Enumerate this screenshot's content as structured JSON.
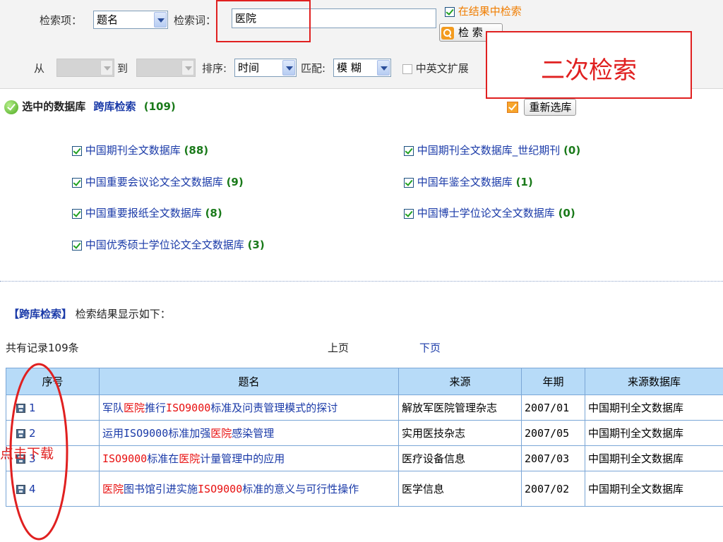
{
  "search": {
    "field_label": "检索项：",
    "field_value": "题名",
    "term_label": "检索词：",
    "term_value": "医院",
    "in_results_label": "在结果中检索",
    "search_button": "检 索",
    "from_label": "从",
    "to_label": "到",
    "sort_label": "排序:",
    "sort_value": "时间",
    "match_label": "匹配:",
    "match_value": "模 糊",
    "cn_en_label": "中英文扩展"
  },
  "annotations": {
    "secondary_search": "二次检索",
    "click_download": "点击下载"
  },
  "databases": {
    "selected_label": "选中的数据库",
    "cross_search_link": "跨库检索",
    "total": "(109)",
    "reselect_button": "重新选库",
    "items": [
      {
        "name": "中国期刊全文数据库",
        "count": "(88)"
      },
      {
        "name": "中国期刊全文数据库_世纪期刊",
        "count": "(0)"
      },
      {
        "name": "中国重要会议论文全文数据库",
        "count": "(9)"
      },
      {
        "name": "中国年鉴全文数据库",
        "count": "(1)"
      },
      {
        "name": "中国重要报纸全文数据库",
        "count": "(8)"
      },
      {
        "name": "中国博士学位论文全文数据库",
        "count": "(0)"
      },
      {
        "name": "中国优秀硕士学位论文全文数据库",
        "count": "(3)"
      }
    ]
  },
  "results": {
    "heading_bracket": "【跨库检索】",
    "heading_text": "检索结果显示如下：",
    "total_records": "共有记录109条",
    "prev_page": "上页",
    "next_page": "下页",
    "columns": [
      "序号",
      "题名",
      "来源",
      "年期",
      "来源数据库"
    ],
    "rows": [
      {
        "seq": "1",
        "title": [
          {
            "t": "军队",
            "h": false
          },
          {
            "t": "医院",
            "h": true
          },
          {
            "t": "推行",
            "h": false
          },
          {
            "t": "ISO9000",
            "h": true
          },
          {
            "t": "标准及问责管理模式的探讨",
            "h": false
          }
        ],
        "source": "解放军医院管理杂志",
        "issue": "2007/01",
        "db": "中国期刊全文数据库"
      },
      {
        "seq": "2",
        "title": [
          {
            "t": "运用",
            "h": false
          },
          {
            "t": "ISO9000",
            "h": false
          },
          {
            "t": "标准加强",
            "h": false
          },
          {
            "t": "医院",
            "h": true
          },
          {
            "t": "感染管理",
            "h": false
          }
        ],
        "source": "实用医技杂志",
        "issue": "2007/05",
        "db": "中国期刊全文数据库"
      },
      {
        "seq": "3",
        "title": [
          {
            "t": "ISO9000",
            "h": true
          },
          {
            "t": "标准在",
            "h": false
          },
          {
            "t": "医院",
            "h": true
          },
          {
            "t": "计量管理中的应用",
            "h": false
          }
        ],
        "source": "医疗设备信息",
        "issue": "2007/03",
        "db": "中国期刊全文数据库"
      },
      {
        "seq": "4",
        "title": [
          {
            "t": "医院",
            "h": true
          },
          {
            "t": "图书馆引进实施",
            "h": false
          },
          {
            "t": "ISO9000",
            "h": true
          },
          {
            "t": "标准的意义与可行性操作",
            "h": false
          }
        ],
        "source": "医学信息",
        "issue": "2007/02",
        "db": "中国期刊全文数据库"
      }
    ]
  },
  "colors": {
    "annotation_red": "#e02020",
    "link_blue": "#1a3aa8",
    "highlight_red": "#e81010",
    "header_blue": "#b7dbf8",
    "count_green": "#1a7a1a"
  }
}
